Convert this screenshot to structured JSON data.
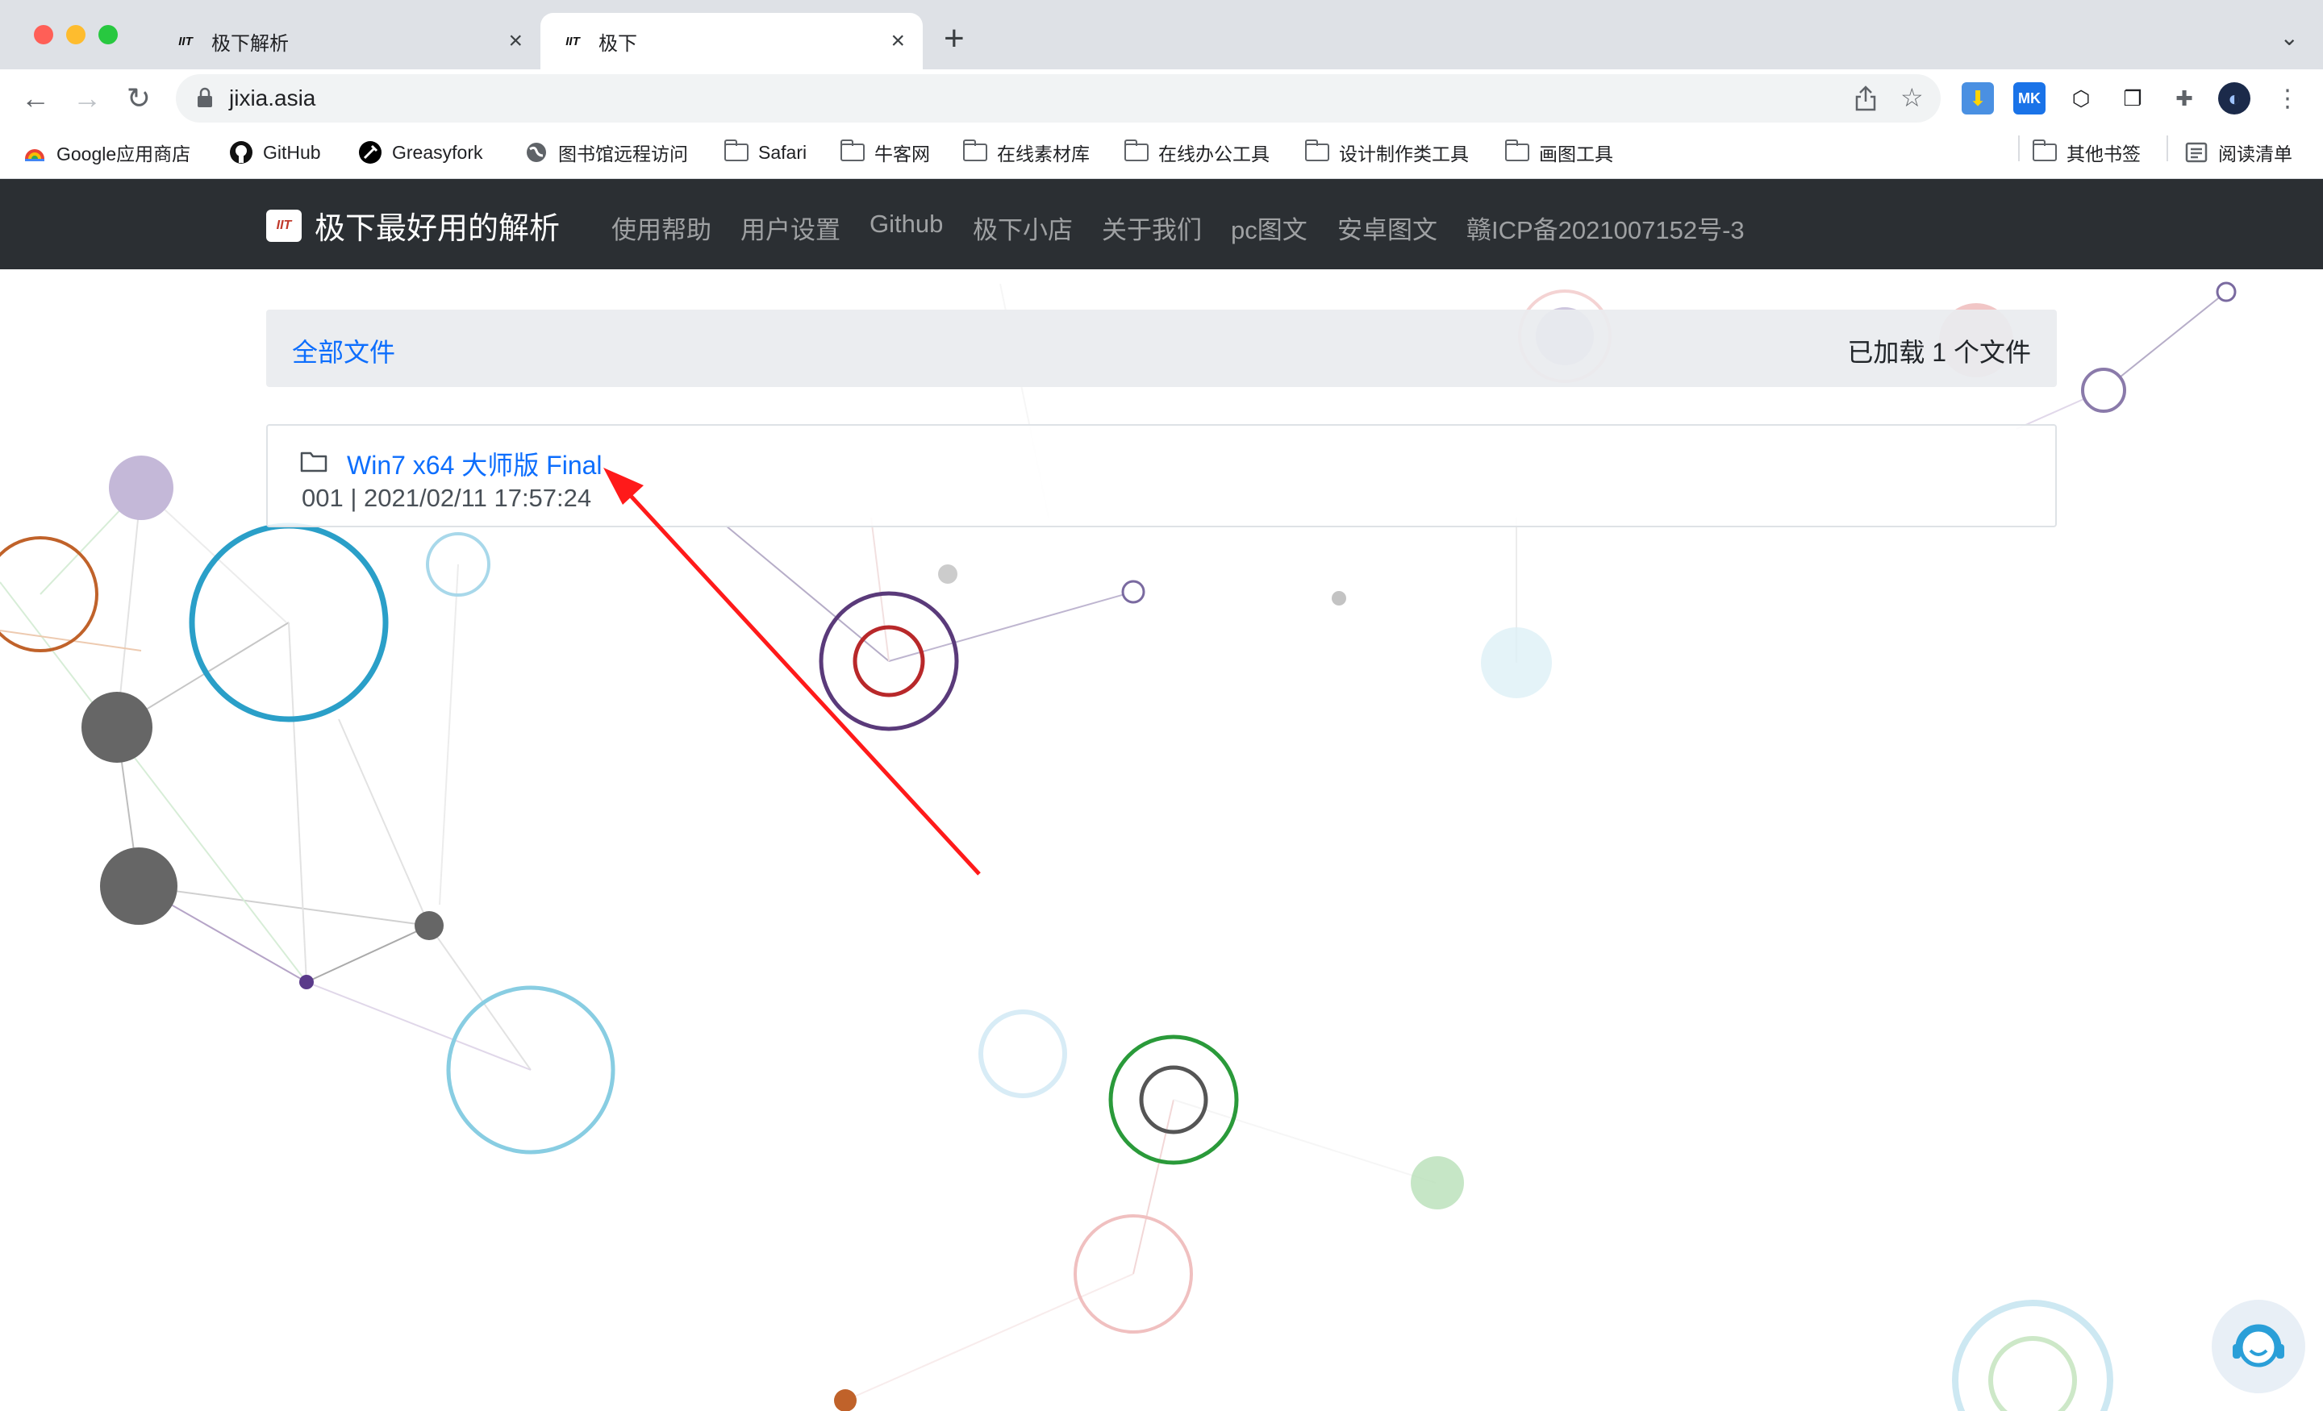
{
  "browser": {
    "tabs": [
      {
        "title": "极下解析",
        "active": false
      },
      {
        "title": "极下",
        "active": true
      }
    ],
    "favicon_text": "IIT",
    "url": "jixia.asia",
    "bookmarks": [
      {
        "label": "Google应用商店",
        "icon": "google-store-icon"
      },
      {
        "label": "GitHub",
        "icon": "github-icon"
      },
      {
        "label": "Greasyfork",
        "icon": "greasyfork-icon"
      },
      {
        "label": "图书馆远程访问",
        "icon": "globe-icon"
      },
      {
        "label": "Safari",
        "icon": "folder-icon"
      },
      {
        "label": "牛客网",
        "icon": "folder-icon"
      },
      {
        "label": "在线素材库",
        "icon": "folder-icon"
      },
      {
        "label": "在线办公工具",
        "icon": "folder-icon"
      },
      {
        "label": "设计制作类工具",
        "icon": "folder-icon"
      },
      {
        "label": "画图工具",
        "icon": "folder-icon"
      }
    ],
    "other_bookmarks": "其他书签",
    "reading_list": "阅读清单"
  },
  "site": {
    "brand": "极下最好用的解析",
    "logo_text": "IIT",
    "nav": [
      "使用帮助",
      "用户设置",
      "Github",
      "极下小店",
      "关于我们",
      "pc图文",
      "安卓图文",
      "赣ICP备2021007152号-3"
    ]
  },
  "breadcrumb": {
    "link": "全部文件",
    "count": "已加载 1 个文件"
  },
  "files": [
    {
      "name": "Win7 x64 大师版 Final",
      "meta": "001 | 2021/02/11 17:57:24"
    }
  ],
  "colors": {
    "navbar_bg": "#2b2f33",
    "link": "#0d6efd",
    "arrow": "#ff0000"
  }
}
